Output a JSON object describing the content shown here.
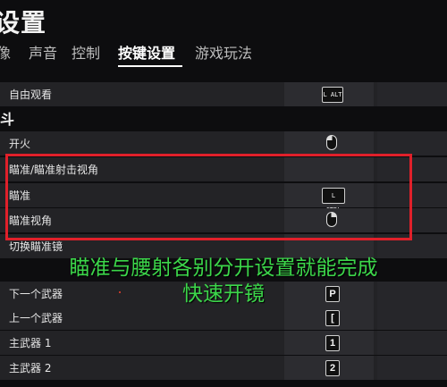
{
  "page": {
    "title": "设置"
  },
  "tabs": [
    {
      "label": "像",
      "active": false
    },
    {
      "label": "声音",
      "active": false
    },
    {
      "label": "控制",
      "active": false
    },
    {
      "label": "按键设置",
      "active": true
    },
    {
      "label": "游戏玩法",
      "active": false
    }
  ],
  "rows": {
    "free_look": {
      "label": "自由观看",
      "key": "L ALT"
    },
    "section_weapon": "斗",
    "fire": {
      "label": "开火",
      "key_icon": "mouse-left-icon"
    },
    "aim_toggle": {
      "label": "瞄准/瞄准射击视角"
    },
    "aim": {
      "label": "瞄准",
      "key": "L CTRL"
    },
    "aim_view": {
      "label": "瞄准视角",
      "key_icon": "mouse-right-icon"
    },
    "switch_sight": {
      "label": "切换瞄准镜"
    },
    "next_weapon": {
      "label": "下一个武器",
      "key": "P"
    },
    "prev_weapon": {
      "label": "上一个武器",
      "key": "["
    },
    "primary1": {
      "label": "主武器 1",
      "key": "1"
    },
    "primary2": {
      "label": "主武器 2",
      "key": "2"
    }
  },
  "overlay": {
    "line1": "瞄准与腰射各别分开设置就能完成",
    "line2": "快速开镜"
  },
  "colors": {
    "highlight_border": "#e0202a",
    "overlay_text": "#3cd64a",
    "background": "#0d0d0f"
  }
}
